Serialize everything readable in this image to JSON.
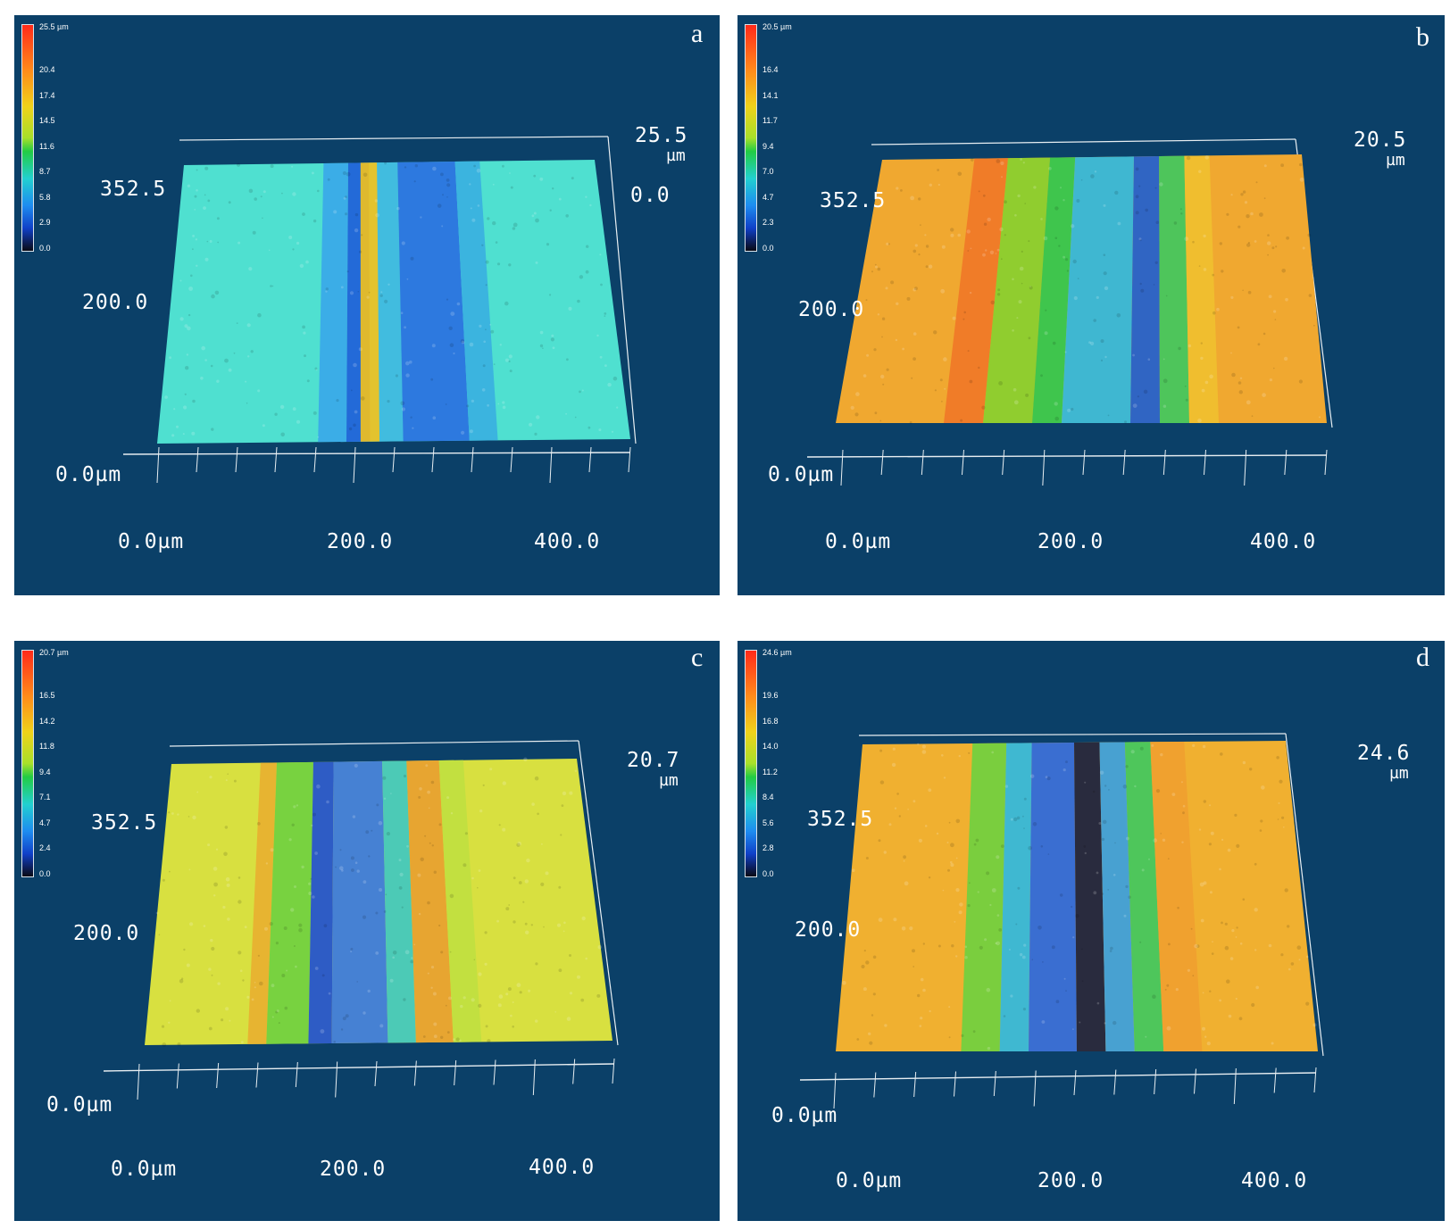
{
  "panels": [
    {
      "letter": "a",
      "colorbar": [
        "25.5 µm",
        "20.4",
        "17.4",
        "14.5",
        "11.6",
        "8.7",
        "5.8",
        "2.9",
        "0.0"
      ],
      "z_max": "25.5",
      "z_unit": "µm",
      "z_min": "0.0",
      "y_labels": [
        "352.5",
        "200.0",
        "0.0µm"
      ],
      "x_labels": [
        "0.0µm",
        "200.0",
        "400.0"
      ],
      "base_color": "#4fe0d0",
      "stripes": [
        {
          "from": 0.34,
          "to": 0.4,
          "color": "#3aa8e8"
        },
        {
          "from": 0.4,
          "to": 0.45,
          "color": "#2060d8"
        },
        {
          "from": 0.43,
          "to": 0.47,
          "color": "#f0c020"
        },
        {
          "from": 0.47,
          "to": 0.52,
          "color": "#40b8e0"
        },
        {
          "from": 0.52,
          "to": 0.66,
          "color": "#2a70e0"
        },
        {
          "from": 0.66,
          "to": 0.72,
          "color": "#3ab0e0"
        }
      ]
    },
    {
      "letter": "b",
      "colorbar": [
        "20.5 µm",
        "16.4",
        "14.1",
        "11.7",
        "9.4",
        "7.0",
        "4.7",
        "2.3",
        "0.0"
      ],
      "z_max": "20.5",
      "z_unit": "µm",
      "z_min": "",
      "y_labels": [
        "352.5",
        "200.0",
        "0.0µm"
      ],
      "x_labels": [
        "0.0µm",
        "200.0",
        "400.0"
      ],
      "base_color": "#f0a830",
      "stripes": [
        {
          "from": 0.22,
          "to": 0.3,
          "color": "#f07828"
        },
        {
          "from": 0.3,
          "to": 0.4,
          "color": "#88d030"
        },
        {
          "from": 0.4,
          "to": 0.46,
          "color": "#30c850"
        },
        {
          "from": 0.46,
          "to": 0.6,
          "color": "#30b8e0"
        },
        {
          "from": 0.6,
          "to": 0.66,
          "color": "#2060d0"
        },
        {
          "from": 0.66,
          "to": 0.72,
          "color": "#40c860"
        },
        {
          "from": 0.72,
          "to": 0.78,
          "color": "#f0c030"
        }
      ]
    },
    {
      "letter": "c",
      "colorbar": [
        "20.7 µm",
        "16.5",
        "14.2",
        "11.8",
        "9.4",
        "7.1",
        "4.7",
        "2.4",
        "0.0"
      ],
      "z_max": "20.7",
      "z_unit": "µm",
      "z_min": "",
      "y_labels": [
        "352.5",
        "200.0",
        "0.0µm"
      ],
      "x_labels": [
        "0.0µm",
        "200.0",
        "400.0"
      ],
      "base_color": "#d8e040",
      "stripes": [
        {
          "from": 0.22,
          "to": 0.26,
          "color": "#e8b030"
        },
        {
          "from": 0.26,
          "to": 0.35,
          "color": "#70d040"
        },
        {
          "from": 0.35,
          "to": 0.4,
          "color": "#2050d0"
        },
        {
          "from": 0.4,
          "to": 0.52,
          "color": "#3a78e0"
        },
        {
          "from": 0.52,
          "to": 0.58,
          "color": "#40c8c0"
        },
        {
          "from": 0.58,
          "to": 0.66,
          "color": "#e8a030"
        },
        {
          "from": 0.66,
          "to": 0.72,
          "color": "#c0e040"
        }
      ]
    },
    {
      "letter": "d",
      "colorbar": [
        "24.6 µm",
        "19.6",
        "16.8",
        "14.0",
        "11.2",
        "8.4",
        "5.6",
        "2.8",
        "0.0"
      ],
      "z_max": "24.6",
      "z_unit": "µm",
      "z_min": "",
      "y_labels": [
        "352.5",
        "200.0",
        "0.0µm"
      ],
      "x_labels": [
        "0.0µm",
        "200.0",
        "400.0"
      ],
      "base_color": "#f0b030",
      "stripes": [
        {
          "from": 0.26,
          "to": 0.34,
          "color": "#70d040"
        },
        {
          "from": 0.34,
          "to": 0.4,
          "color": "#30b8e0"
        },
        {
          "from": 0.4,
          "to": 0.5,
          "color": "#2a68e0"
        },
        {
          "from": 0.5,
          "to": 0.56,
          "color": "#182040"
        },
        {
          "from": 0.56,
          "to": 0.62,
          "color": "#3aa0e0"
        },
        {
          "from": 0.62,
          "to": 0.68,
          "color": "#40c860"
        },
        {
          "from": 0.68,
          "to": 0.76,
          "color": "#f0a030"
        }
      ]
    }
  ]
}
